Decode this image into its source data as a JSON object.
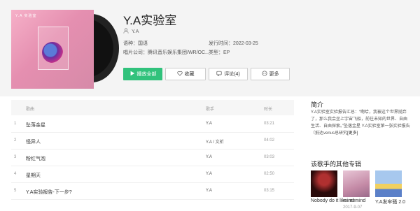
{
  "album": {
    "cover_label": "Y.A 实验室",
    "title": "Y.A实验室",
    "artist": "Y.A",
    "language_label": "语种：",
    "language": "国语",
    "release_label": "发行时间：",
    "release_date": "2022-03-25",
    "company_label": "唱片公司：",
    "company": "腾讯音乐娱乐集团/WR/OC...",
    "type_label": "类型：",
    "type": "EP"
  },
  "actions": {
    "play_all": "播放全部",
    "favorite": "收藏",
    "comment": "评论(4)",
    "more": "更多"
  },
  "tracklist": {
    "headers": {
      "song": "歌曲",
      "singer": "歌手",
      "duration": "时长"
    },
    "rows": [
      {
        "num": "1",
        "name": "坠落金星",
        "singer": "Y.A",
        "duration": "03:21"
      },
      {
        "num": "2",
        "name": "怪异人",
        "singer": "Y.A / 文祈",
        "duration": "04:02"
      },
      {
        "num": "3",
        "name": "粉红气泡",
        "singer": "Y.A",
        "duration": "03:03"
      },
      {
        "num": "4",
        "name": "星期天",
        "singer": "Y.A",
        "duration": "02:50"
      },
      {
        "num": "5",
        "name": "Y.A实验报告-下一步?",
        "singer": "Y.A",
        "duration": "03:15"
      }
    ]
  },
  "sidebar": {
    "intro_title": "简介",
    "intro_text": "Y.A实验室实验报告汇总：“啊哈，我被这个世界抛弃了，那么我会坐上宇宙飞船，前往未知的世界、自由生活、自由探索。”坠落金星 Y.A实验室第一张实验报告（抵达venus总研究",
    "intro_more": "[更多]",
    "other_albums_title": "该歌手的其他专辑",
    "other_albums": [
      {
        "name": "Nobody do it like me",
        "date": ""
      },
      {
        "name": "mind mind",
        "date": "2017-9-07"
      },
      {
        "name": "Y.A发牢骚 2.0",
        "date": ""
      }
    ]
  },
  "colors": {
    "accent": "#31c27c",
    "band": "#f4f4f4"
  }
}
